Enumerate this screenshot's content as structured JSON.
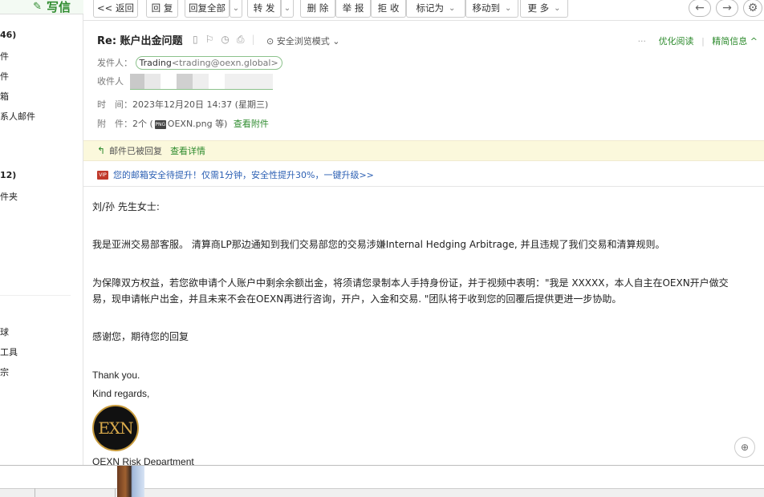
{
  "sidebar": {
    "compose_label": "写信",
    "items": [
      {
        "label": "46)",
        "bold": true
      },
      {
        "label": "件"
      },
      {
        "label": "件"
      },
      {
        "label": "箱"
      },
      {
        "label": "系人邮件"
      },
      {
        "label": "12)",
        "bold": true
      },
      {
        "label": "件夹"
      },
      {
        "label": "球"
      },
      {
        "label": "工具"
      },
      {
        "label": "宗"
      }
    ]
  },
  "toolbar": {
    "back": "<< 返回",
    "reply": "回 复",
    "reply_all": "回复全部",
    "forward": "转 发",
    "delete": "删 除",
    "report": "举 报",
    "reject": "拒 收",
    "mark_as": "标记为",
    "move_to": "移动到",
    "more": "更 多",
    "prev_icon": "←",
    "next_icon": "→",
    "settings_icon": "⚙"
  },
  "header": {
    "subject": "Re: 账户出金问题",
    "safe_mode": "安全浏览模式",
    "optimize_read": "优化阅读",
    "brief_info": "精简信息"
  },
  "meta": {
    "from_label": "发件人：",
    "from_name": "Trading",
    "from_addr": "<trading@oexn.global>",
    "to_label": "收件人",
    "time_label": "时　间：",
    "time_value": "2023年12月20日 14:37 (星期三)",
    "attach_label": "附　件：",
    "attach_count": "2个 (",
    "attach_file": "OEXN.png 等)",
    "attach_view": "查看附件"
  },
  "notice": {
    "replied": "邮件已被回复",
    "details": "查看详情"
  },
  "upgrade": {
    "badge": "VIP",
    "text": "您的邮箱安全待提升！仅需1分钟，安全性提升30%，一键升级>>"
  },
  "body": {
    "greeting": "刘/孙 先生女士:",
    "para1": "我是亚洲交易部客服。 清算商LP那边通知到我们交易部您的交易涉嫌Internal Hedging Arbitrage, 并且违规了我们交易和清算规则。",
    "para2_line1": "为保障双方权益，若您欲申请个人账户中剩余余额出金，将须请您录制本人手持身份证，并于视频中表明：\"我是 XXXXX，本人自主在OEXN开户做交",
    "para2_line2": "易，现申请帐户出金，并且未来不会在OEXN再进行咨询，开户，入金和交易. \"团队将于收到您的回覆后提供更进一步协助。",
    "thanks_cn": "感谢您，期待您的回复",
    "thanks_en": "Thank you.",
    "regards": "Kind regards,",
    "logo_text": "EXN",
    "signature": "OEXN Risk Department"
  }
}
